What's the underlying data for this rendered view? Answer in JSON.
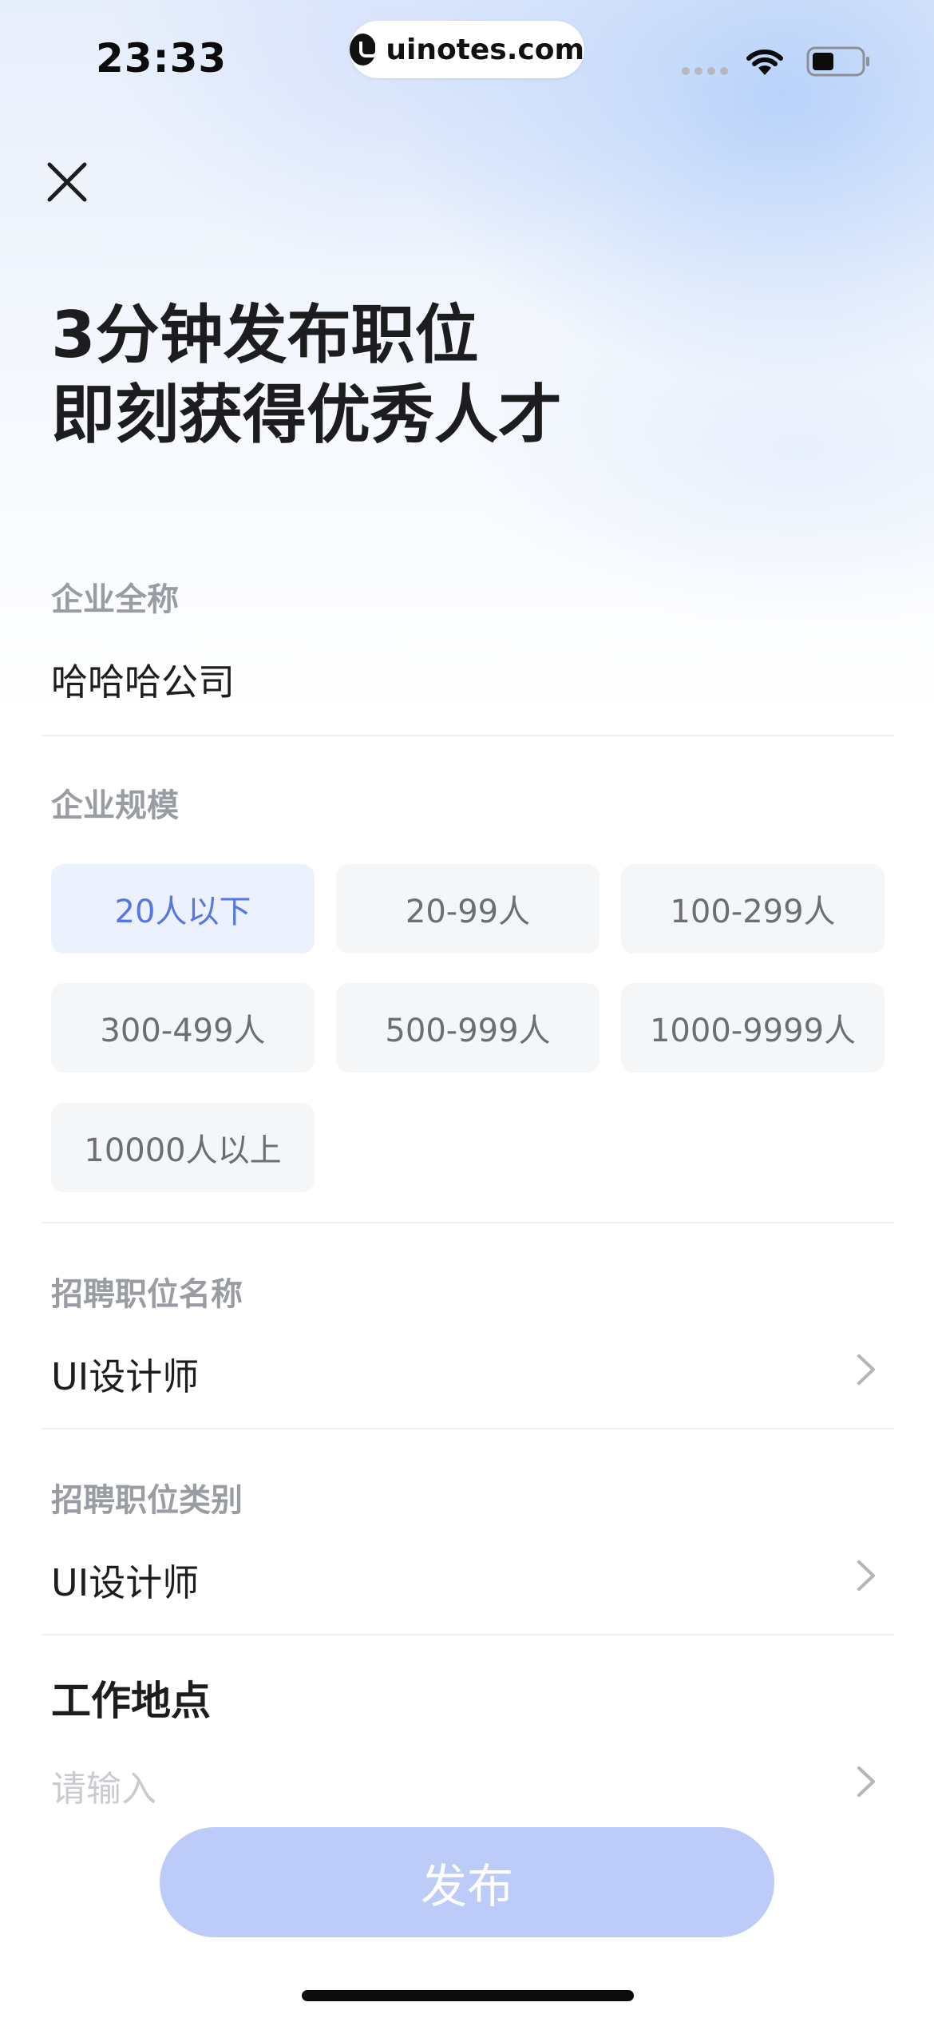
{
  "status_bar": {
    "time": "23:33",
    "url": "uinotes.com"
  },
  "header": {
    "close_icon": "close-icon",
    "title_line1": "3分钟发布职位",
    "title_line2": "即刻获得优秀人才"
  },
  "company_name": {
    "label": "企业全称",
    "value": "哈哈哈公司"
  },
  "company_size": {
    "label": "企业规模",
    "options": [
      "20人以下",
      "20-99人",
      "100-299人",
      "300-499人",
      "500-999人",
      "1000-9999人",
      "10000人以上"
    ],
    "selected": "20人以下"
  },
  "position_name": {
    "label": "招聘职位名称",
    "value": "UI设计师"
  },
  "position_category": {
    "label": "招聘职位类别",
    "value": "UI设计师"
  },
  "work_location": {
    "label": "工作地点",
    "placeholder": "请输入"
  },
  "publish": {
    "label": "发布"
  },
  "colors": {
    "accent": "#5676e5",
    "selected_bg": "#ecf1fe",
    "button_disabled": "#bccbf8"
  }
}
